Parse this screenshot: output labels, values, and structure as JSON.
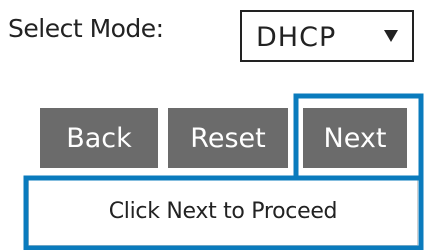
{
  "mode": {
    "label": "Select Mode:",
    "selected": "DHCP"
  },
  "buttons": {
    "back_label": "Back",
    "reset_label": "Reset",
    "next_label": "Next"
  },
  "status": {
    "message": "Click Next to Proceed"
  },
  "colors": {
    "button_bg": "#6b6b6b",
    "button_text": "#ffffff",
    "highlight_outline": "#0a7bbd",
    "text": "#222222"
  },
  "icons": {
    "dropdown": "chevron-down-icon"
  }
}
